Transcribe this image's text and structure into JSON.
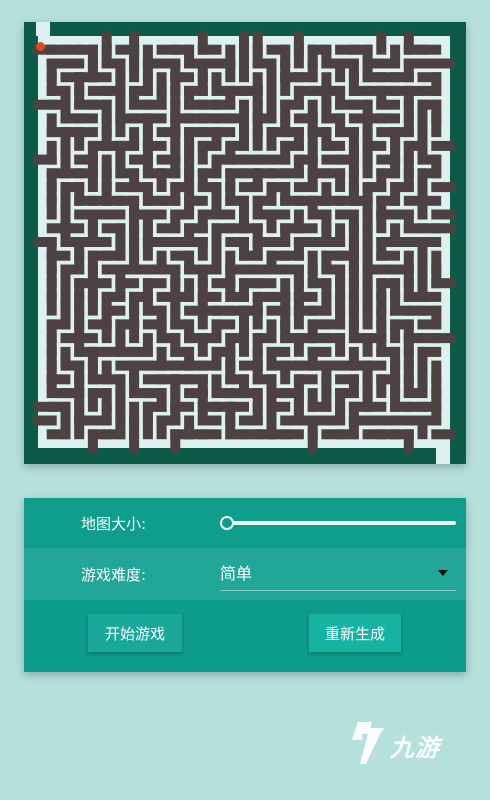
{
  "colors": {
    "background": "#b6e0dc",
    "maze_border": "#0c5a48",
    "maze_wall": "#4e4143",
    "maze_path": "#ddf2f0",
    "player": "#e64a19",
    "panel": "#0e9c8a"
  },
  "settings": {
    "size_label": "地图大小:",
    "size_slider_value": 0.0,
    "difficulty_label": "游戏难度:",
    "difficulty_value": "简单"
  },
  "buttons": {
    "start_label": "开始游戏",
    "regenerate_label": "重新生成"
  },
  "watermark": {
    "text": "九游"
  }
}
